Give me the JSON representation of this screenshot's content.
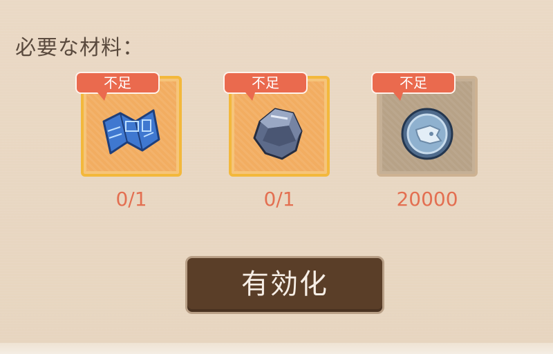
{
  "materials_title": "必要な材料：",
  "materials": [
    {
      "badge": "不足",
      "count": "0/1",
      "icon": "blueprint-map-icon",
      "available": true
    },
    {
      "badge": "不足",
      "count": "0/1",
      "icon": "ore-rock-icon",
      "available": true
    },
    {
      "badge": "不足",
      "count": "20000",
      "icon": "silver-coin-icon",
      "available": false
    }
  ],
  "activate_label": "有効化",
  "colors": {
    "badge": "#ea6a4e",
    "count_text": "#e36f51",
    "slot_active": "#f2ad61",
    "slot_inactive": "#b7a287",
    "button": "#5a3e28"
  }
}
